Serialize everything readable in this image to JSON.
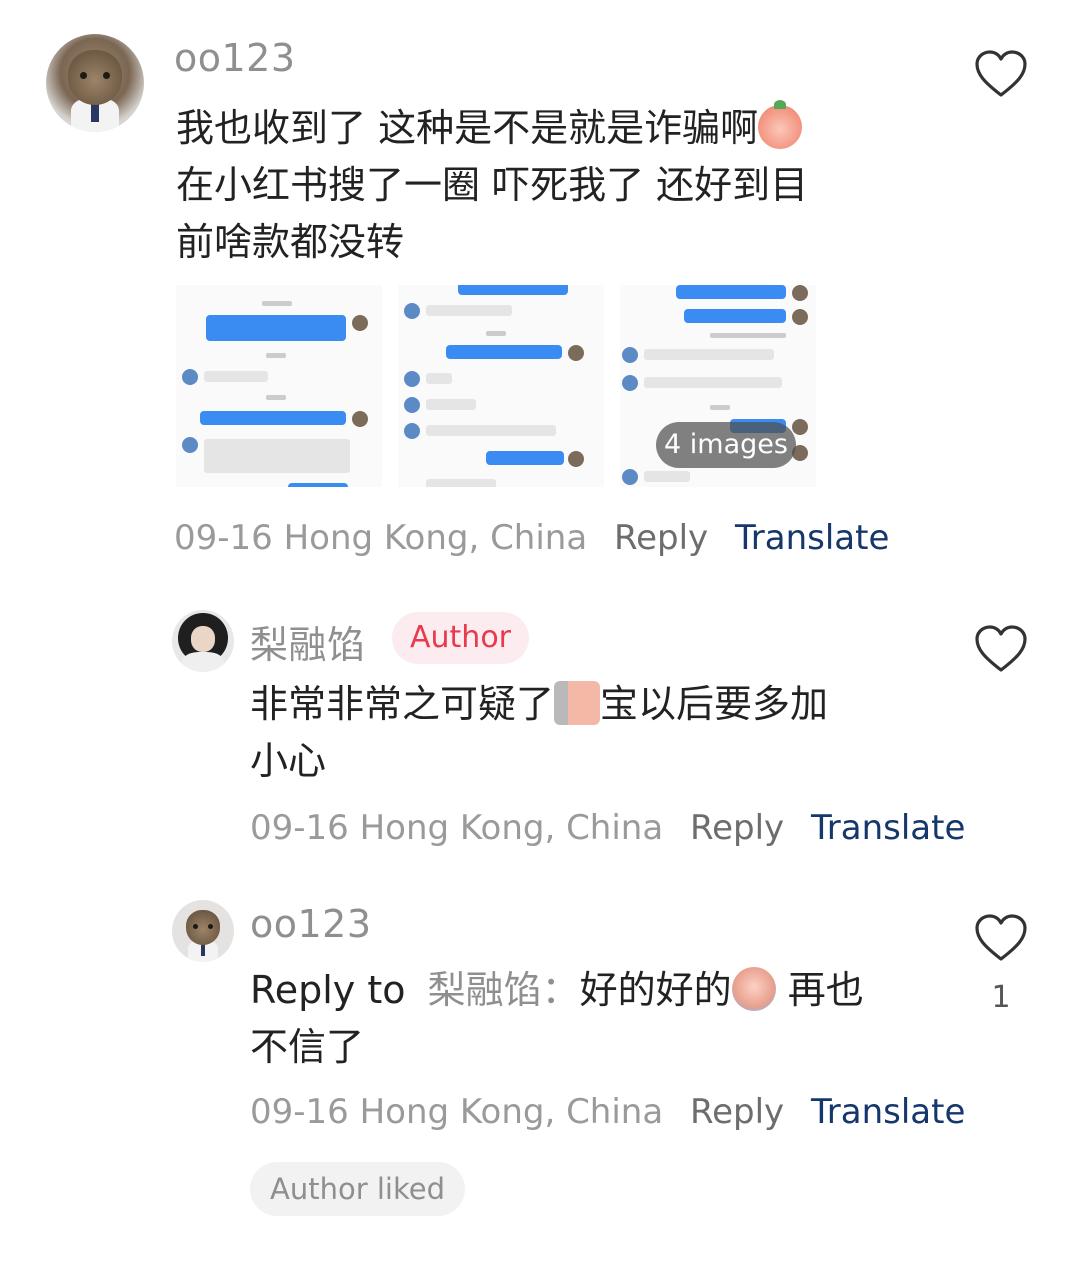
{
  "comments": [
    {
      "username": "oo123",
      "text_line1": "我也收到了 这种是不是就是诈骗啊",
      "text_line2": "在小红书搜了一圈 吓死我了 还好到目",
      "text_line3": "前啥款都没转",
      "emoji": "peach-scream-icon",
      "images_more_label": "4 images",
      "date": "09-16",
      "location": "Hong Kong, China",
      "reply_label": "Reply",
      "translate_label": "Translate"
    },
    {
      "username": "梨融馅",
      "badge": "Author",
      "text_line1_a": "非常非常之可疑了",
      "text_line1_b": "宝以后要多加",
      "text_line2": "小心",
      "emoji": "peach-wall-peek-icon",
      "date": "09-16",
      "location": "Hong Kong, China",
      "reply_label": "Reply",
      "translate_label": "Translate"
    },
    {
      "username": "oo123",
      "reply_to_prefix": "Reply to",
      "reply_to_name": "梨融馅：",
      "text_line1_a": "好的好的",
      "text_line1_b": " 再也",
      "text_line2": "不信了",
      "emoji": "peach-crying-icon",
      "date": "09-16",
      "location": "Hong Kong, China",
      "reply_label": "Reply",
      "translate_label": "Translate",
      "like_count": "1",
      "author_liked_label": "Author liked"
    }
  ],
  "colors": {
    "username": "#8f8f8f",
    "translate": "#15376b",
    "author_badge_text": "#e8394d",
    "author_badge_bg": "#fdecef"
  }
}
